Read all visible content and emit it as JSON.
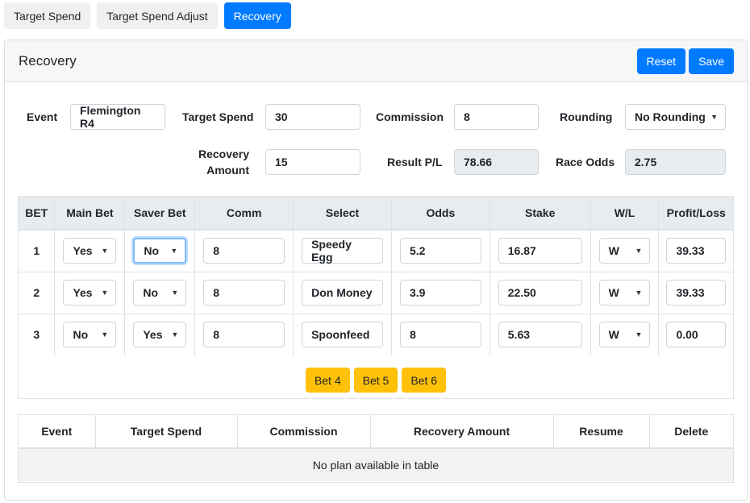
{
  "tabs": [
    {
      "label": "Target Spend"
    },
    {
      "label": "Target Spend Adjust"
    },
    {
      "label": "Recovery"
    }
  ],
  "card": {
    "title": "Recovery",
    "reset_label": "Reset",
    "save_label": "Save"
  },
  "form": {
    "event_label": "Event",
    "event_value": "Flemington R4",
    "target_spend_label": "Target Spend",
    "target_spend_value": "30",
    "commission_label": "Commission",
    "commission_value": "8",
    "rounding_label": "Rounding",
    "rounding_value": "No Rounding",
    "recovery_label_1": "Recovery",
    "recovery_label_2": "Amount",
    "recovery_value": "15",
    "result_label": "Result P/L",
    "result_value": "78.66",
    "race_odds_label": "Race Odds",
    "race_odds_value": "2.75"
  },
  "bets_table": {
    "headers": [
      "BET",
      "Main Bet",
      "Saver Bet",
      "Comm",
      "Select",
      "Odds",
      "Stake",
      "W/L",
      "Profit/Loss"
    ],
    "rows": [
      {
        "bet": "1",
        "main": "Yes",
        "saver": "No",
        "comm": "8",
        "select": "Speedy Egg",
        "odds": "5.2",
        "stake": "16.87",
        "wl": "W",
        "pl": "39.33"
      },
      {
        "bet": "2",
        "main": "Yes",
        "saver": "No",
        "comm": "8",
        "select": "Don Money",
        "odds": "3.9",
        "stake": "22.50",
        "wl": "W",
        "pl": "39.33"
      },
      {
        "bet": "3",
        "main": "No",
        "saver": "Yes",
        "comm": "8",
        "select": "Spoonfeed",
        "odds": "8",
        "stake": "5.63",
        "wl": "W",
        "pl": "0.00"
      }
    ],
    "add_buttons": [
      "Bet 4",
      "Bet 5",
      "Bet 6"
    ]
  },
  "plan_table": {
    "headers": [
      "Event",
      "Target Spend",
      "Commission",
      "Recovery Amount",
      "Resume",
      "Delete"
    ],
    "empty_text": "No plan available in table"
  },
  "colors": {
    "primary": "#007bff",
    "warning": "#ffc107",
    "readonly_bg": "#e9ecef"
  }
}
